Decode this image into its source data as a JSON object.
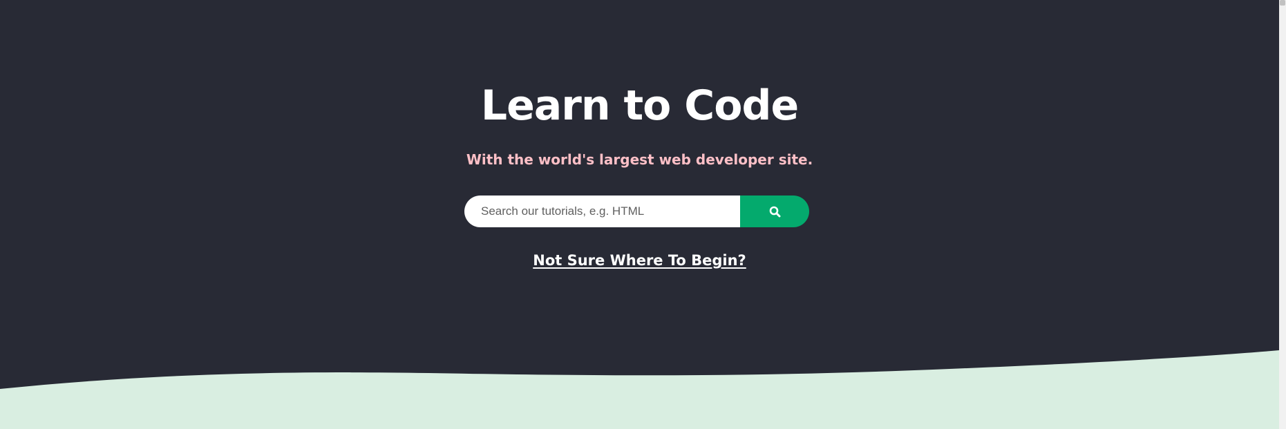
{
  "hero": {
    "title": "Learn to Code",
    "subtitle": "With the world's largest web developer site.",
    "search": {
      "placeholder": "Search our tutorials, e.g. HTML",
      "value": "",
      "button_icon": "search-icon"
    },
    "begin_link": "Not Sure Where To Begin?"
  },
  "colors": {
    "background": "#282a35",
    "title": "#ffffff",
    "subtitle": "#ffc0c7",
    "search_button": "#04aa6d",
    "wave": "#d9eee1"
  }
}
